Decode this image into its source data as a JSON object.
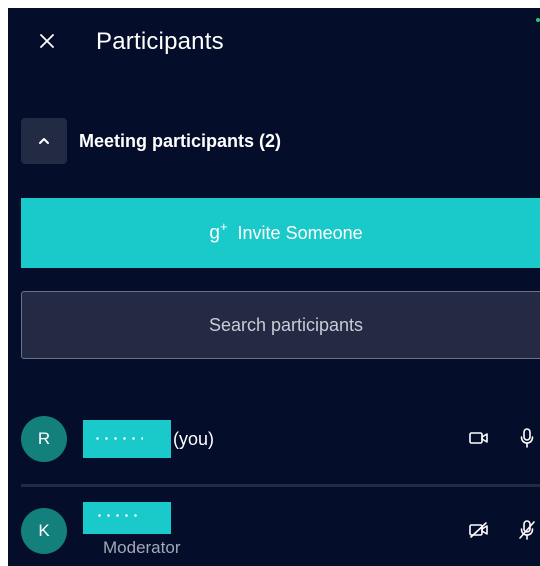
{
  "panel": {
    "title": "Participants"
  },
  "section": {
    "title": "Meeting participants (2)"
  },
  "invite": {
    "icon_glyph": "g",
    "icon_plus": "+",
    "label": "Invite Someone"
  },
  "search": {
    "placeholder": "Search participants"
  },
  "participants": [
    {
      "initial": "R",
      "name_redacted": "",
      "suffix": "(you)",
      "role": "",
      "camera": "on",
      "mic": "on"
    },
    {
      "initial": "K",
      "name_redacted": "",
      "suffix": "",
      "role": "Moderator",
      "camera": "off",
      "mic": "muted"
    }
  ],
  "colors": {
    "background": "#040d2a",
    "accent": "#1ac9c9",
    "avatar": "#13807b",
    "field": "#242a43"
  }
}
